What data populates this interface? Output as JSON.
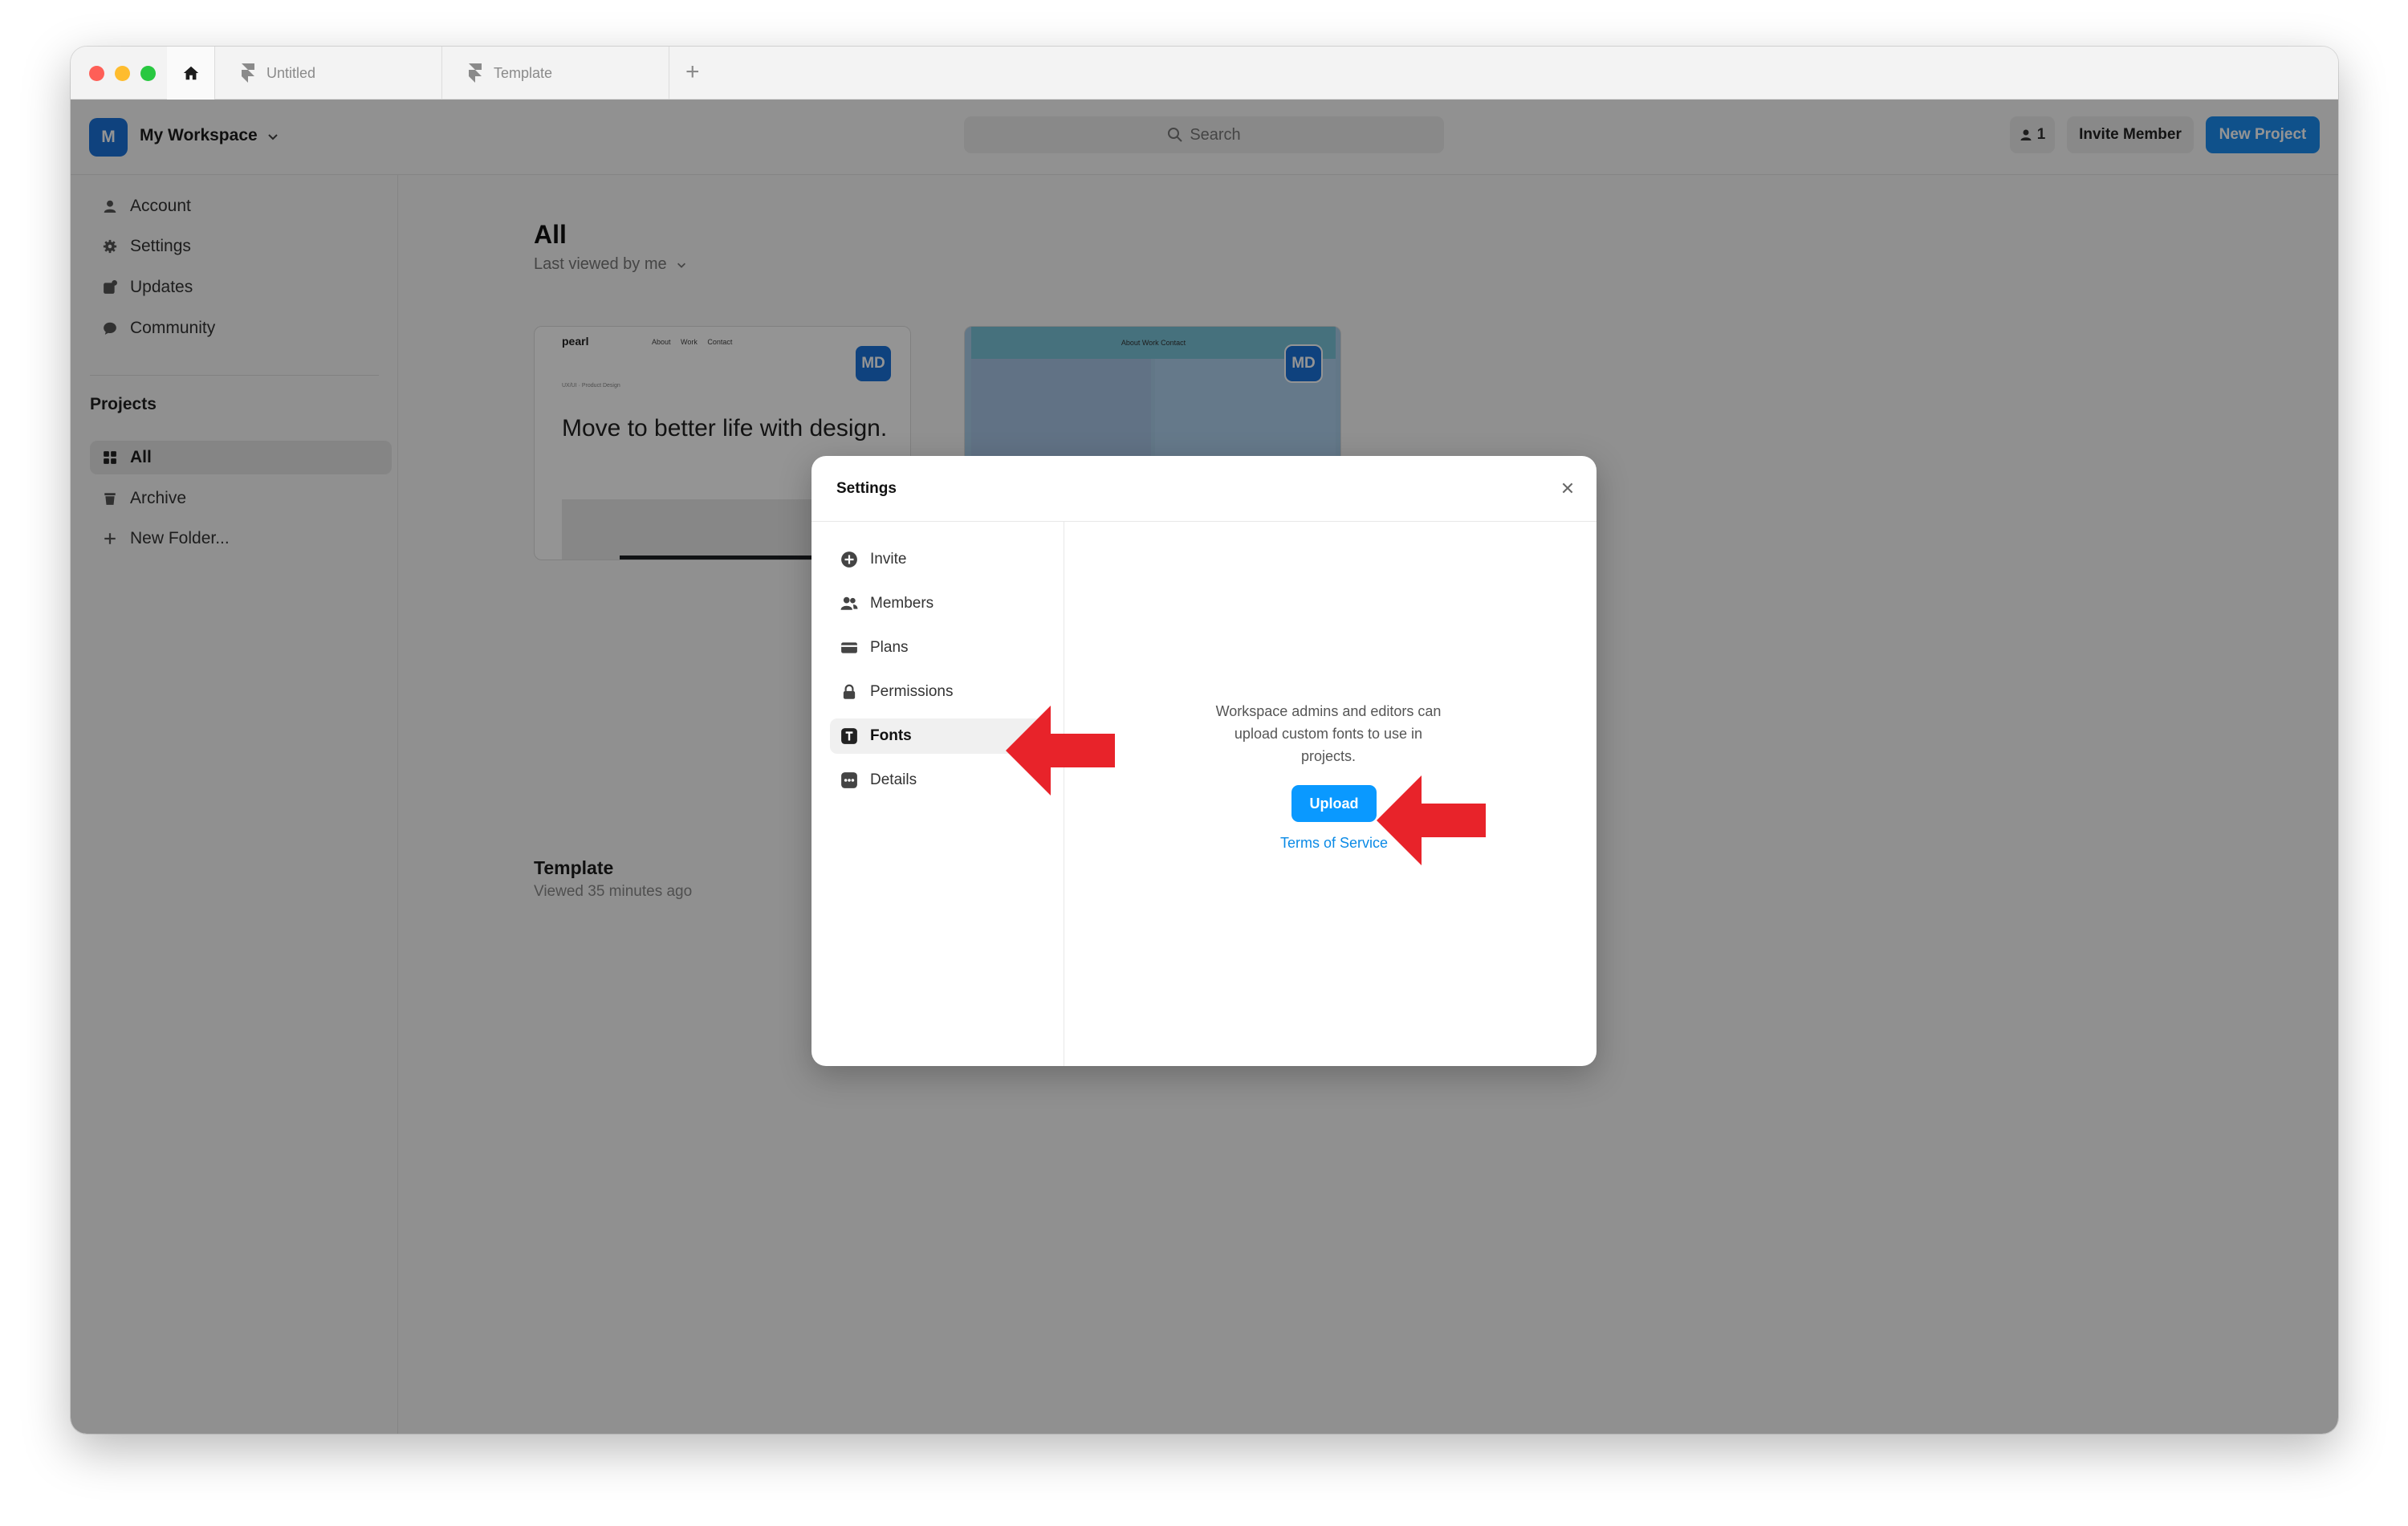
{
  "tabs": {
    "home_icon": "house-icon",
    "items": [
      {
        "label": "Untitled",
        "icon": "framer-logo-icon"
      },
      {
        "label": "Template",
        "icon": "framer-logo-icon"
      }
    ],
    "add_label": "+"
  },
  "workspace": {
    "avatar_letter": "M",
    "name": "My Workspace"
  },
  "search": {
    "placeholder": "Search"
  },
  "header": {
    "member_count": "1",
    "invite_label": "Invite Member",
    "new_project_label": "New Project"
  },
  "sidebar": {
    "items": [
      {
        "label": "Account",
        "icon": "person-icon"
      },
      {
        "label": "Settings",
        "icon": "gear-icon"
      },
      {
        "label": "Updates",
        "icon": "updates-icon"
      },
      {
        "label": "Community",
        "icon": "chat-bubble-icon"
      }
    ],
    "projects_heading": "Projects",
    "project_items": [
      {
        "label": "All",
        "icon": "grid-icon",
        "active": true
      },
      {
        "label": "Archive",
        "icon": "trash-icon"
      },
      {
        "label": "New Folder...",
        "icon": "plus-icon"
      }
    ]
  },
  "main": {
    "title": "All",
    "sort_label": "Last viewed by me"
  },
  "cards": [
    {
      "badge": "MD",
      "preview_logo": "pearl",
      "preview_nav": "About Work Contact",
      "preview_small": "UX/UI · Product Design",
      "preview_headline": "Move to better life with design.",
      "title": "Template",
      "subtitle": "Viewed 35 minutes ago"
    },
    {
      "badge": "MD",
      "preview_nav": "About Work Contact"
    }
  ],
  "modal": {
    "title": "Settings",
    "close_icon": "close-icon",
    "nav": [
      {
        "label": "Invite",
        "icon": "plus-circle-icon"
      },
      {
        "label": "Members",
        "icon": "people-icon"
      },
      {
        "label": "Plans",
        "icon": "card-icon"
      },
      {
        "label": "Permissions",
        "icon": "lock-icon"
      },
      {
        "label": "Fonts",
        "icon": "text-icon",
        "active": true
      },
      {
        "label": "Details",
        "icon": "details-icon"
      }
    ],
    "description": "Workspace admins and editors can upload custom fonts to use in projects.",
    "upload_label": "Upload",
    "terms_label": "Terms of Service"
  },
  "colors": {
    "accent": "#0a99ff",
    "avatar": "#1a73d9",
    "annotation_arrow": "#e8232a"
  }
}
